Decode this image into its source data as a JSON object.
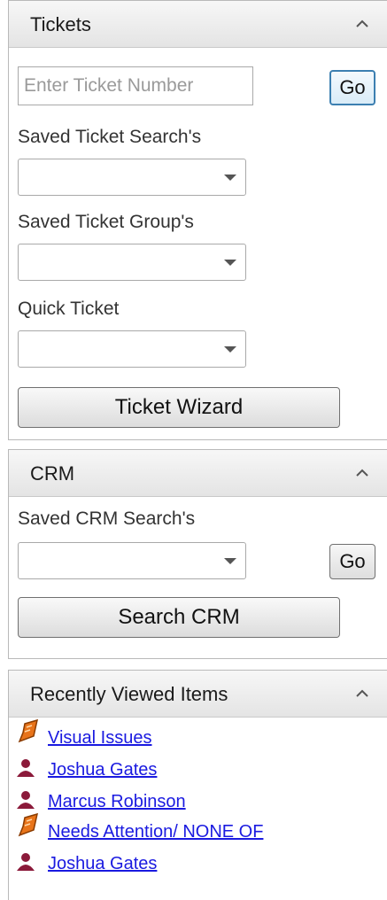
{
  "tickets": {
    "title": "Tickets",
    "ticket_number_placeholder": "Enter Ticket Number",
    "go_label": "Go",
    "saved_search_label": "Saved Ticket Search's",
    "saved_group_label": "Saved Ticket Group's",
    "quick_ticket_label": "Quick Ticket",
    "wizard_label": "Ticket Wizard"
  },
  "crm": {
    "title": "CRM",
    "saved_search_label": "Saved CRM Search's",
    "go_label": "Go",
    "search_label": "Search CRM"
  },
  "recent": {
    "title": "Recently Viewed Items",
    "items": [
      {
        "label": "Visual Issues",
        "icon": "ticket-icon"
      },
      {
        "label": "Joshua Gates",
        "icon": "person-icon"
      },
      {
        "label": "Marcus Robinson",
        "icon": "person-icon"
      },
      {
        "label": "Needs Attention/ NONE OF",
        "icon": "ticket-icon"
      },
      {
        "label": "Joshua Gates",
        "icon": "person-icon"
      }
    ]
  },
  "colors": {
    "link": "#1a1ae0",
    "ticket_icon": "#e8741a",
    "person_icon": "#8b1a3a",
    "focus_border": "#3c7fb1"
  }
}
